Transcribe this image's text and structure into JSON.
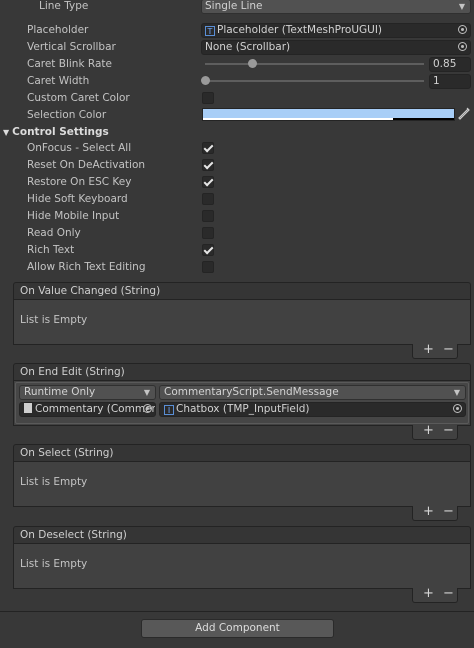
{
  "properties": {
    "line_type": {
      "label": "Line Type",
      "value": "Single Line"
    },
    "placeholder": {
      "label": "Placeholder",
      "value": "Placeholder (TextMeshProUGUI)"
    },
    "vertical_scrollbar": {
      "label": "Vertical Scrollbar",
      "value": "None (Scrollbar)"
    },
    "caret_blink_rate": {
      "label": "Caret Blink Rate",
      "value": "0.85",
      "fraction": 0.2125
    },
    "caret_width": {
      "label": "Caret Width",
      "value": "1",
      "fraction": 0.0
    },
    "custom_caret_color": {
      "label": "Custom Caret Color",
      "checked": false
    },
    "selection_color": {
      "label": "Selection Color",
      "color": "#a8cef7"
    }
  },
  "control_settings": {
    "title": "Control Settings",
    "items": [
      {
        "label": "OnFocus - Select All",
        "checked": true
      },
      {
        "label": "Reset On DeActivation",
        "checked": true
      },
      {
        "label": "Restore On ESC Key",
        "checked": true
      },
      {
        "label": "Hide Soft Keyboard",
        "checked": false
      },
      {
        "label": "Hide Mobile Input",
        "checked": false
      },
      {
        "label": "Read Only",
        "checked": false
      },
      {
        "label": "Rich Text",
        "checked": true
      },
      {
        "label": "Allow Rich Text Editing",
        "checked": false
      }
    ]
  },
  "events": {
    "value_changed": {
      "title": "On Value Changed (String)",
      "empty": "List is Empty"
    },
    "end_edit": {
      "title": "On End Edit (String)",
      "runtime": "Runtime Only",
      "function": "CommentaryScript.SendMessage",
      "object": "Commentary (Commen",
      "argument": "Chatbox (TMP_InputField)"
    },
    "select": {
      "title": "On Select (String)",
      "empty": "List is Empty"
    },
    "deselect": {
      "title": "On Deselect (String)",
      "empty": "List is Empty"
    }
  },
  "footer": {
    "plus": "+",
    "minus": "−",
    "add_component": "Add Component"
  }
}
